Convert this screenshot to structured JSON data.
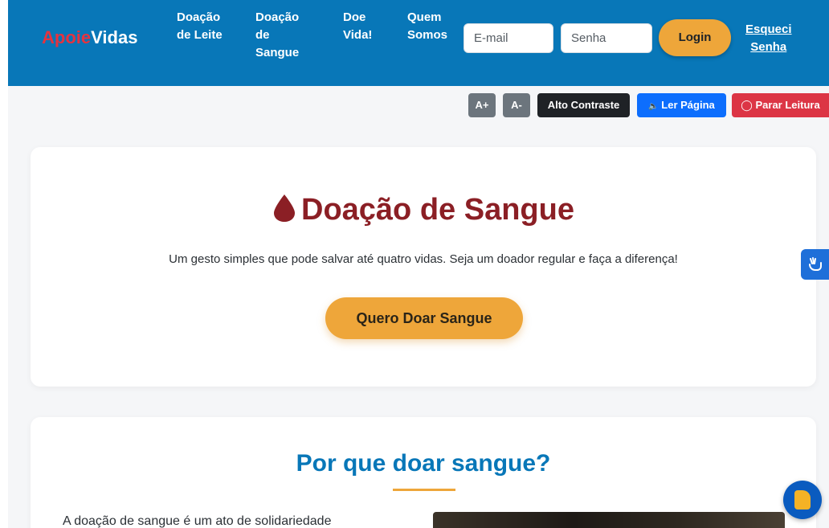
{
  "brand": {
    "part1": "Apoie",
    "part2": "Vidas"
  },
  "nav": {
    "leite": [
      "Doação",
      "de Leite"
    ],
    "sangue": [
      "Doação",
      "de",
      "Sangue"
    ],
    "vida": [
      "Doe",
      "Vida!"
    ],
    "quem": [
      "Quem",
      "Somos"
    ]
  },
  "login": {
    "email_placeholder": "E-mail",
    "senha_placeholder": "Senha",
    "button": "Login",
    "forgot": [
      "Esqueci",
      "Senha"
    ]
  },
  "accessibility": {
    "increase": "A+",
    "decrease": "A-",
    "contrast": "Alto Contraste",
    "read_icon": "🔈",
    "read": "Ler Página",
    "stop_icon": "◯",
    "stop": "Parar Leitura"
  },
  "hero": {
    "title": "Doação de Sangue",
    "subtitle": "Um gesto simples que pode salvar até quatro vidas. Seja um doador regular e faça a diferença!",
    "cta": "Quero Doar Sangue"
  },
  "why": {
    "title": "Por que doar sangue?",
    "text": "A doação de sangue é um ato de solidariedade"
  },
  "icons": {
    "drop": "blood-drop-icon",
    "vlibras": "sign-language-hands-icon",
    "assistant": "accessibility-assistant-icon"
  },
  "colors": {
    "primary": "#0877b8",
    "accent": "#eea63a",
    "brand_red": "#e5333f",
    "title_red": "#8b1f25"
  }
}
